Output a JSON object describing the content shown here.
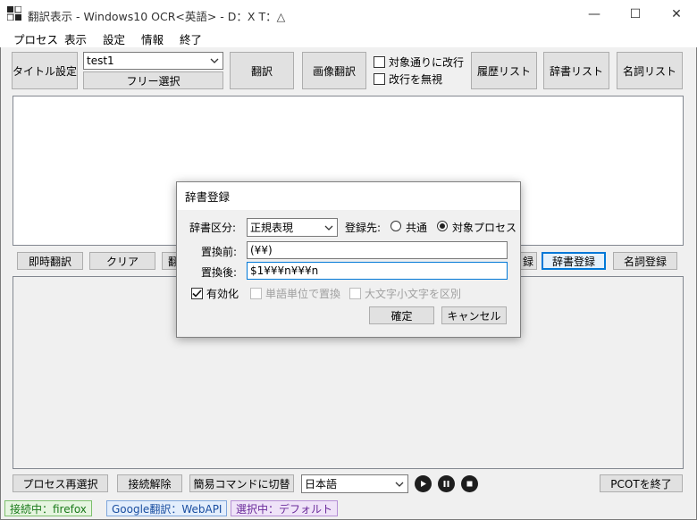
{
  "window": {
    "title": "翻訳表示 - Windows10 OCR<英語> - D：X T：△",
    "controls": {
      "minimize": "—",
      "maximize": "☐",
      "close": "✕"
    }
  },
  "menu": {
    "items": [
      "プロセス",
      "表示",
      "設定",
      "情報",
      "終了"
    ]
  },
  "toolbar": {
    "title_settings": "タイトル設定",
    "title_combo_value": "test1",
    "free_select": "フリー選択",
    "translate": "翻訳",
    "image_translate": "画像翻訳",
    "chk_newline_target": "対象通りに改行",
    "chk_ignore_newline": "改行を無視",
    "history_list": "履歴リスト",
    "dictionary_list": "辞書リスト",
    "noun_list": "名詞リスト"
  },
  "middle_buttons": {
    "instant_translate": "即時翻訳",
    "clear": "クリア",
    "partial": "翻",
    "partial_right": "録",
    "dict_register": "辞書登録",
    "noun_register": "名詞登録"
  },
  "bottom": {
    "reselect_process": "プロセス再選択",
    "disconnect": "接続解除",
    "switch_simple": "簡易コマンドに切替",
    "language": "日本語",
    "exit_pcot": "PCOTを終了"
  },
  "status": {
    "connected": "接続中：firefox",
    "engine": "Google翻訳：WebAPI",
    "selected": "選択中：デフォルト",
    "colors": {
      "connected_bg": "#e6f5e0",
      "connected_fg": "#1a7a1a",
      "engine_bg": "#e3eefc",
      "engine_fg": "#1a4ea0",
      "selected_bg": "#efe3f8",
      "selected_fg": "#6a2a9a"
    }
  },
  "dialog": {
    "title": "辞書登録",
    "category_label": "辞書区分:",
    "category_value": "正規表現",
    "target_label": "登録先:",
    "radio_common": "共通",
    "radio_process": "対象プロセス",
    "radio_selected": "対象プロセス",
    "before_label": "置換前:",
    "before_value": "(¥¥)",
    "after_label": "置換後:",
    "after_value": "$1¥¥¥n¥¥¥n",
    "chk_enable": "有効化",
    "chk_enable_checked": true,
    "chk_word_unit": "単語単位で置換",
    "chk_case": "大文字小文字を区別",
    "ok": "確定",
    "cancel": "キャンセル"
  },
  "icons": [
    "app-icon",
    "chevron-down-icon",
    "play-icon",
    "pause-icon",
    "stop-icon",
    "check-icon"
  ]
}
